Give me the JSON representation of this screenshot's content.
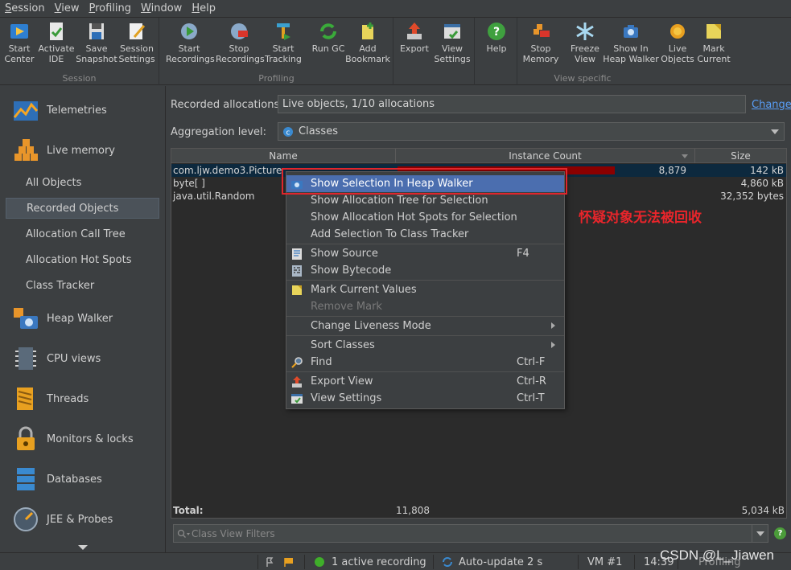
{
  "menubar": {
    "items": [
      "Session",
      "View",
      "Profiling",
      "Window",
      "Help"
    ]
  },
  "toolbar": {
    "groups": [
      {
        "label": "Session",
        "buttons": [
          {
            "label1": "Start",
            "label2": "Center",
            "icon": "start-center-icon"
          },
          {
            "label1": "Activate",
            "label2": "IDE",
            "icon": "activate-ide-icon"
          },
          {
            "label1": "Save",
            "label2": "Snapshot",
            "icon": "save-icon"
          },
          {
            "label1": "Session",
            "label2": "Settings",
            "icon": "session-settings-icon"
          }
        ]
      },
      {
        "label": "Profiling",
        "buttons": [
          {
            "label1": "Start",
            "label2": "Recordings",
            "icon": "start-recordings-icon"
          },
          {
            "label1": "Stop",
            "label2": "Recordings",
            "icon": "stop-recordings-icon"
          },
          {
            "label1": "Start",
            "label2": "Tracking",
            "icon": "start-tracking-icon"
          },
          {
            "label1": "Run GC",
            "label2": "",
            "icon": "run-gc-icon"
          },
          {
            "label1": "Add",
            "label2": "Bookmark",
            "icon": "add-bookmark-icon"
          }
        ]
      },
      {
        "label": "",
        "buttons": [
          {
            "label1": "Export",
            "label2": "",
            "icon": "export-icon"
          },
          {
            "label1": "View",
            "label2": "Settings",
            "icon": "view-settings-icon"
          }
        ]
      },
      {
        "label": "",
        "buttons": [
          {
            "label1": "Help",
            "label2": "",
            "icon": "help-icon"
          }
        ]
      },
      {
        "label": "View specific",
        "buttons": [
          {
            "label1": "Stop",
            "label2": "Memory",
            "icon": "stop-memory-icon"
          },
          {
            "label1": "Freeze",
            "label2": "View",
            "icon": "freeze-view-icon"
          },
          {
            "label1": "Show In",
            "label2": "Heap Walker",
            "icon": "show-in-heap-walker-icon"
          },
          {
            "label1": "Live",
            "label2": "Objects",
            "icon": "live-objects-icon"
          },
          {
            "label1": "Mark",
            "label2": "Current",
            "icon": "mark-current-icon"
          }
        ]
      }
    ]
  },
  "sidebar": {
    "categories": [
      {
        "label": "Telemetries",
        "icon": "telemetries-icon"
      },
      {
        "label": "Live memory",
        "icon": "live-memory-icon"
      },
      {
        "label": "Heap Walker",
        "icon": "heap-walker-icon"
      },
      {
        "label": "CPU views",
        "icon": "cpu-views-icon"
      },
      {
        "label": "Threads",
        "icon": "threads-icon"
      },
      {
        "label": "Monitors & locks",
        "icon": "monitors-locks-icon"
      },
      {
        "label": "Databases",
        "icon": "databases-icon"
      },
      {
        "label": "JEE & Probes",
        "icon": "jee-probes-icon"
      }
    ],
    "live_memory_items": [
      "All Objects",
      "Recorded Objects",
      "Allocation Call Tree",
      "Allocation Hot Spots",
      "Class Tracker"
    ],
    "selected": "Recorded Objects"
  },
  "main": {
    "recorded_label": "Recorded allocations:",
    "recorded_value": "Live objects, 1/10 allocations",
    "change_link": "Change",
    "aggregation_label": "Aggregation level:",
    "aggregation_value": "Classes",
    "table": {
      "columns": [
        "Name",
        "Instance Count",
        "Size"
      ],
      "rows": [
        {
          "name": "com.ljw.demo3.Picture",
          "count": "8,879",
          "size": "142 kB",
          "bar_fraction": 0.75
        },
        {
          "name": "byte[ ]",
          "count": "",
          "size": "4,860 kB"
        },
        {
          "name": "java.util.Random",
          "count": "",
          "size": "32,352 bytes"
        }
      ],
      "total_label": "Total:",
      "total_count": "11,808",
      "total_size": "5,034 kB"
    },
    "filter_placeholder": "Class View Filters"
  },
  "context_menu": {
    "items": [
      {
        "label": "Show Selection In Heap Walker",
        "shortcut": "",
        "icon": "heap-walker-icon",
        "highlighted": true
      },
      {
        "label": "Show Allocation Tree for Selection",
        "shortcut": ""
      },
      {
        "label": "Show Allocation Hot Spots for Selection",
        "shortcut": ""
      },
      {
        "label": "Add Selection To Class Tracker",
        "shortcut": ""
      },
      {
        "label": "Show Source",
        "shortcut": "F4",
        "icon": "source-icon"
      },
      {
        "label": "Show Bytecode",
        "shortcut": "",
        "icon": "bytecode-icon"
      },
      {
        "label": "Mark Current Values",
        "shortcut": "",
        "icon": "mark-icon"
      },
      {
        "label": "Remove Mark",
        "shortcut": "",
        "disabled": true
      },
      {
        "label": "Change Liveness Mode",
        "shortcut": "",
        "submenu": true
      },
      {
        "label": "Sort Classes",
        "shortcut": "",
        "submenu": true
      },
      {
        "label": "Find",
        "shortcut": "Ctrl-F",
        "icon": "find-icon"
      },
      {
        "label": "Export View",
        "shortcut": "Ctrl-R",
        "icon": "export-icon"
      },
      {
        "label": "View Settings",
        "shortcut": "Ctrl-T",
        "icon": "view-settings-icon"
      }
    ]
  },
  "annotation": "怀疑对象无法被回收",
  "statusbar": {
    "recording": "1 active recording",
    "autoupdate": "Auto-update 2 s",
    "vm": "VM #1",
    "time": "14:39",
    "mode": "Profiling"
  },
  "watermark": "CSDN @L_Jiawen",
  "colors": {
    "accent": "#4b6eaf",
    "link": "#589df6",
    "alert": "#e8252b",
    "bar": "#8b0000"
  }
}
